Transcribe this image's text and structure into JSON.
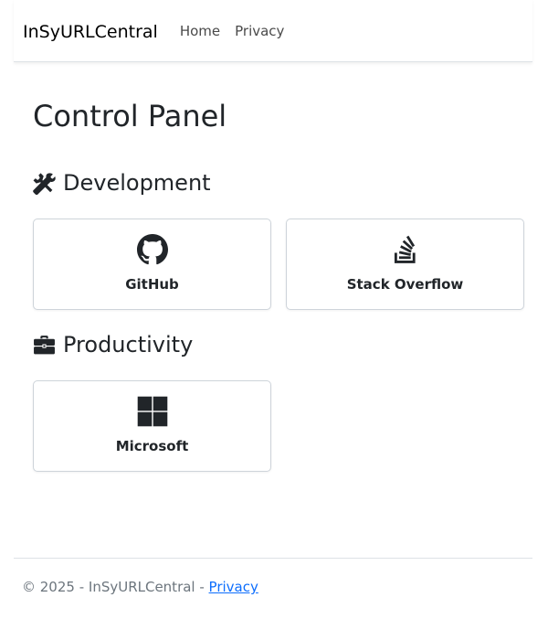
{
  "nav": {
    "brand": "InSyURLCentral",
    "links": [
      "Home",
      "Privacy"
    ]
  },
  "main": {
    "title": "Control Panel",
    "sections": [
      {
        "heading": "Development",
        "icon": "tools-icon",
        "cards": [
          {
            "label": "GitHub",
            "icon": "github-icon"
          },
          {
            "label": "Stack Overflow",
            "icon": "stack-overflow-icon"
          }
        ]
      },
      {
        "heading": "Productivity",
        "icon": "briefcase-icon",
        "cards": [
          {
            "label": "Microsoft",
            "icon": "windows-icon"
          }
        ]
      }
    ]
  },
  "footer": {
    "text": "© 2025 - InSyURLCentral - ",
    "link": "Privacy"
  },
  "colors": {
    "link": "#0d6efd",
    "text": "#212529",
    "icon": "#212529",
    "border": "#ced4da"
  }
}
